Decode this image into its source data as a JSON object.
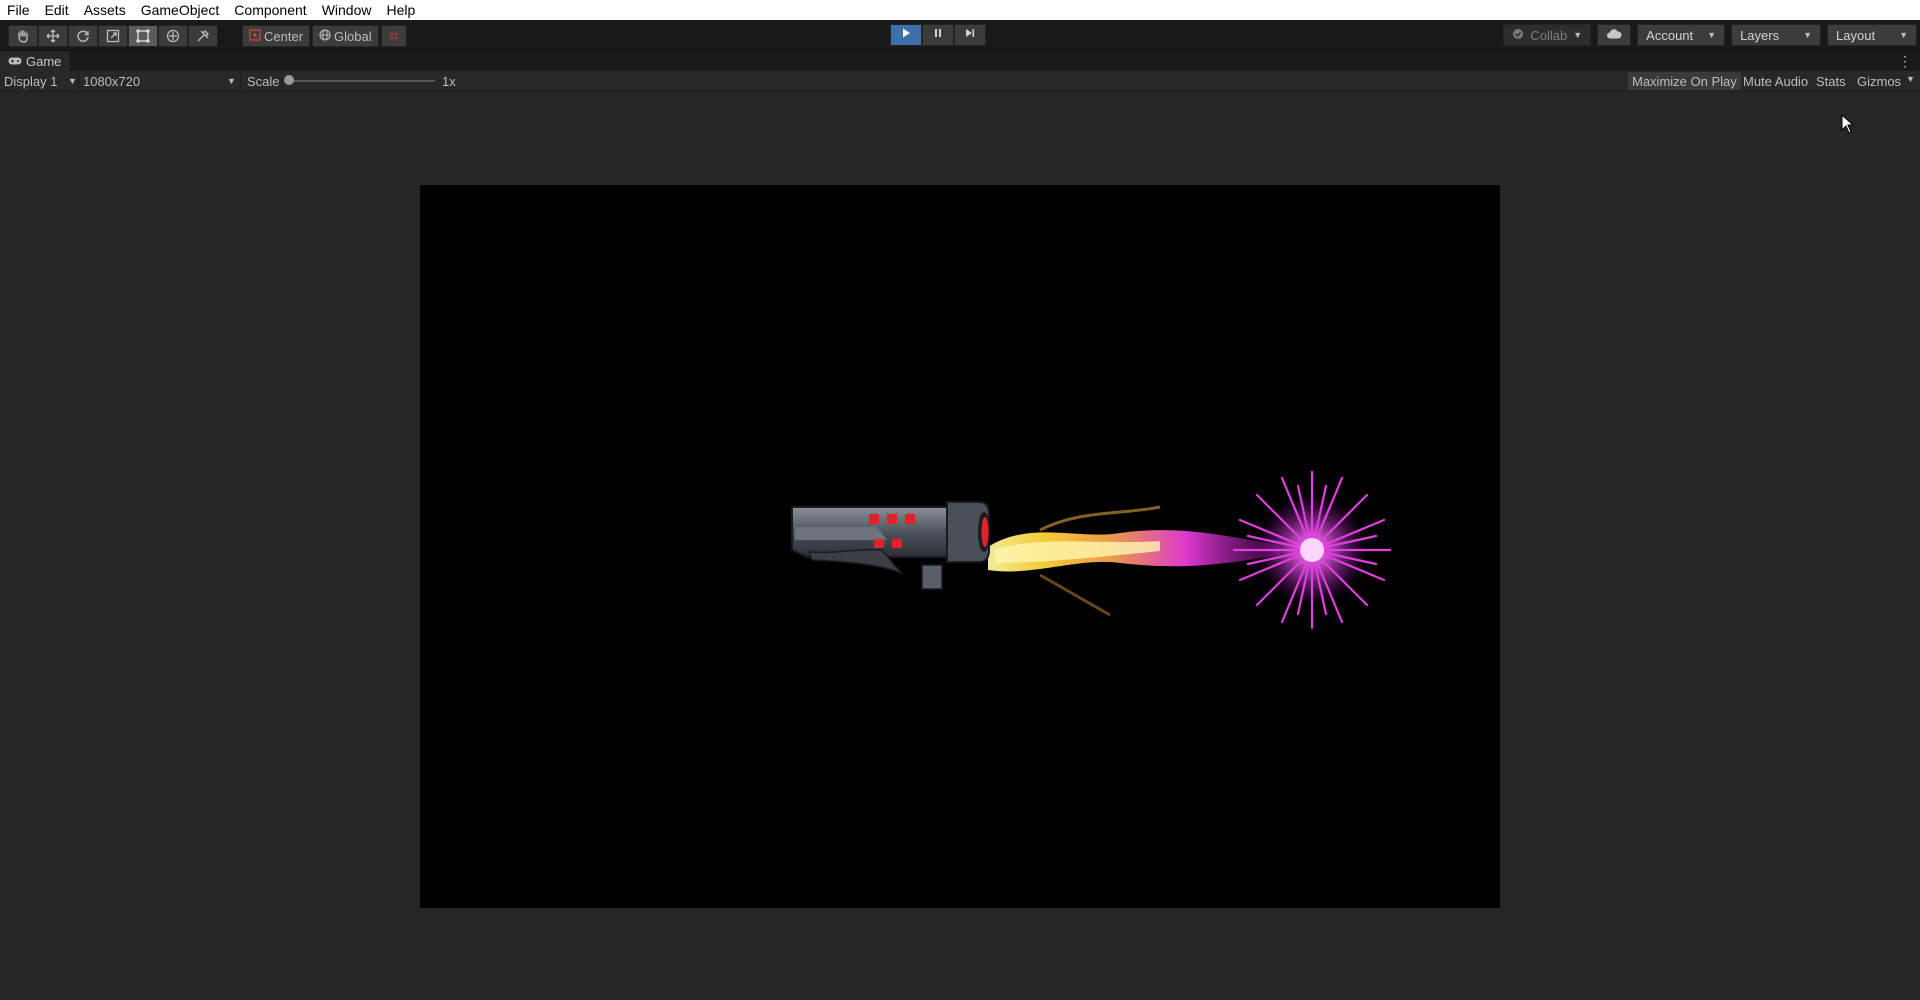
{
  "menu": [
    "File",
    "Edit",
    "Assets",
    "GameObject",
    "Component",
    "Window",
    "Help"
  ],
  "toolbar": {
    "tools": [
      "hand-tool-icon",
      "move-tool-icon",
      "rotate-tool-icon",
      "scale-tool-icon",
      "rect-tool-icon",
      "transform-tool-icon",
      "custom-tool-icon"
    ],
    "active_tool": "rect-tool-icon",
    "pivot_mode": "Center",
    "pivot_rotation": "Global",
    "collab": "Collab",
    "account": "Account",
    "layers": "Layers",
    "layout": "Layout"
  },
  "game_tab": {
    "title": "Game"
  },
  "game_toolbar": {
    "display": "Display 1",
    "resolution": "1080x720",
    "scale_label": "Scale",
    "scale_value": "1x",
    "maximize": "Maximize On Play",
    "mute": "Mute Audio",
    "stats": "Stats",
    "gizmos": "Gizmos"
  },
  "colors": {
    "editor_bg": "#282828",
    "toolbar_bg": "#191919",
    "play_active": "#3d6fa8",
    "game_bg": "#000000",
    "flame_yellow": "#ffe34a",
    "flame_magenta": "#e12bd9",
    "gun_red": "#e0232b"
  }
}
